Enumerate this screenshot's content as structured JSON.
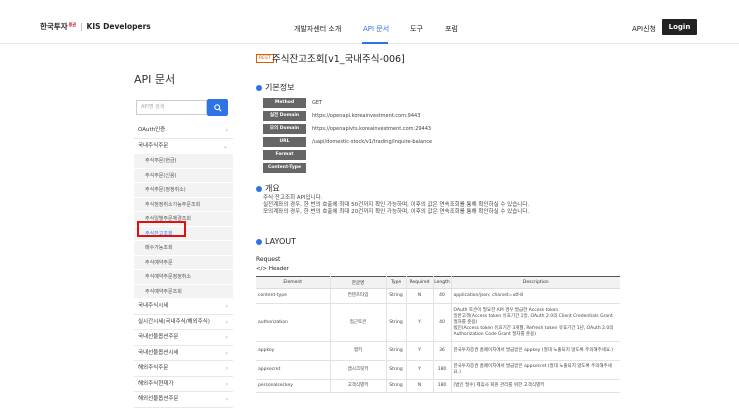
{
  "header": {
    "logo_kr": "한국투자",
    "logo_sup": "증권",
    "logo_sep": "|",
    "logo_dev": "KIS Developers",
    "nav": [
      "개발자센터 소개",
      "API 문서",
      "도구",
      "포럼"
    ],
    "apply": "API신청",
    "login": "Login"
  },
  "sidebar": {
    "title": "API 문서",
    "search_placeholder": "API명 검색",
    "top_items": [
      "OAuth인증",
      "국내주식주문"
    ],
    "sub_items": [
      "주식주문(현금)",
      "주식주문(신용)",
      "주식주문(정정취소)",
      "주식정정취소가능주문조회",
      "주식일별주문체결조회",
      "주식잔고조회",
      "매수가능조회",
      "주식예약주문",
      "주식예약주문정정취소",
      "주식예약주문조회"
    ],
    "active_sub": "주식잔고조회",
    "bottom_items": [
      "국내주식시세",
      "실시간시세(국내주식/해외주식)",
      "국내선물옵션주문",
      "국내선물옵션시세",
      "해외주식주문",
      "해외주식현재가",
      "해외선물옵션주문"
    ]
  },
  "content": {
    "badge": "REST",
    "title": "주식잔고조회[v1_국내주식-006]",
    "basic_info_title": "기본정보",
    "basic_info": [
      {
        "key": "Method",
        "value": "GET"
      },
      {
        "key": "실전 Domain",
        "value": "https://openapi.koreainvestment.com:9443"
      },
      {
        "key": "모의 Domain",
        "value": "https://openapivts.koreainvestment.com:29443"
      },
      {
        "key": "URL",
        "value": "/uapi/domestic-stock/v1/trading/inquire-balance"
      },
      {
        "key": "Format",
        "value": ""
      },
      {
        "key": "Content-Type",
        "value": ""
      }
    ],
    "overview_title": "개요",
    "overview_lines": [
      "주식 잔고조회 API입니다.",
      "실전계좌의 경우, 한 번의 호출에 최대 50건까지 확인 가능하며, 이후의 값은 연속조회를 통해 확인하실 수 있습니다.",
      "모의계좌의 경우, 한 번의 호출에 최대 20건까지 확인 가능하며, 이후의 값은 연속조회를 통해 확인하실 수 있습니다."
    ],
    "layout_title": "LAYOUT",
    "request_label": "Request",
    "header_label": "</> Header",
    "table": {
      "columns": [
        "Element",
        "한글명",
        "Type",
        "Required",
        "Length",
        "Description"
      ],
      "rows": [
        [
          "content-type",
          "컨텐츠타입",
          "String",
          "N",
          "40",
          "application/json; charset=utf-8"
        ],
        [
          "authorization",
          "접근토큰",
          "String",
          "Y",
          "40",
          "OAuth 토큰이 필요한 API 경우 발급한 Access token\n일반고객(Access token 유효기간 1일, OAuth 2.0의 Client Credentials Grant 절차를 준용)\n법인(Access token 유효기간 3개월, Refresh token 유효기간 1년, OAuth 2.0의 Authorization Code Grant 절차를 준용)"
        ],
        [
          "appkey",
          "앱키",
          "String",
          "Y",
          "36",
          "한국투자증권 홈페이지에서 발급받은 appkey (절대 노출되지 않도록 주의해주세요.)"
        ],
        [
          "appsecret",
          "앱시크릿키",
          "String",
          "Y",
          "180",
          "한국투자증권 홈페이지에서 발급받은 appsecret (절대 노출되지 않도록 주의해주세요.)"
        ],
        [
          "personalseckey",
          "고객식별키",
          "String",
          "N",
          "180",
          "[법인 필수] 제휴사 회원 관리를 위한 고객식별키"
        ]
      ]
    }
  }
}
